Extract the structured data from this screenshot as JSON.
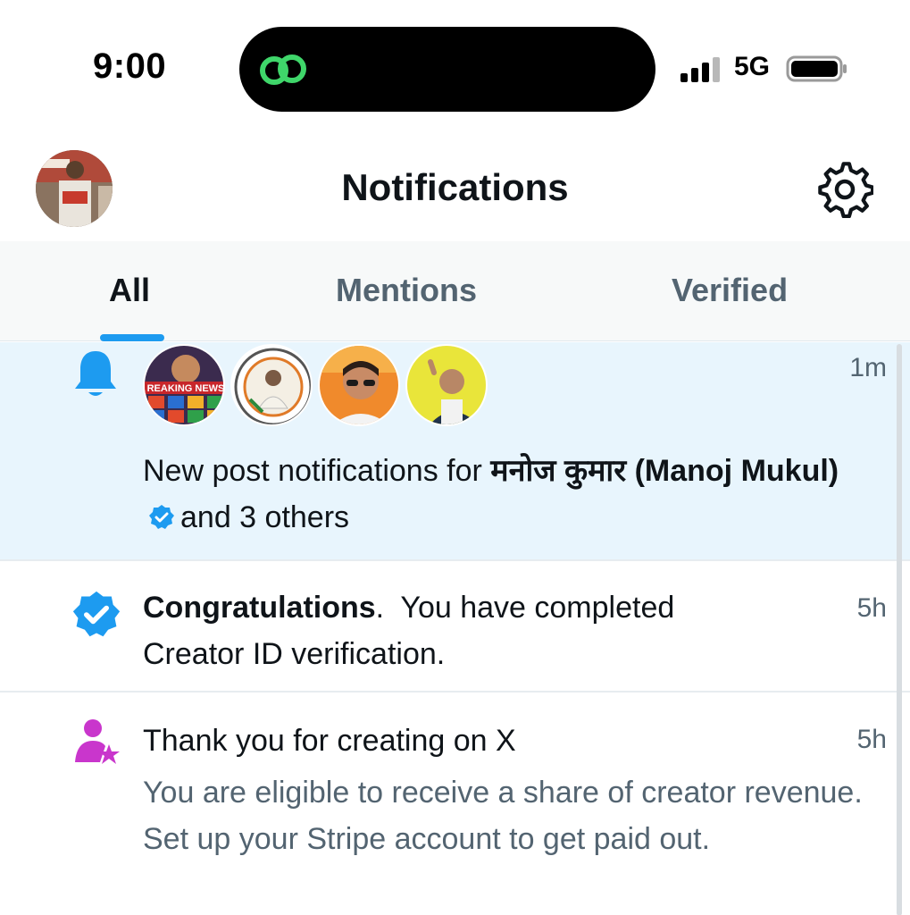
{
  "status_bar": {
    "time": "9:00",
    "network": "5G",
    "icons": [
      "link-icon",
      "signal-icon",
      "battery-icon"
    ]
  },
  "header": {
    "title": "Notifications",
    "settings_icon": "gear-icon"
  },
  "tabs": [
    {
      "label": "All",
      "active": true
    },
    {
      "label": "Mentions",
      "active": false
    },
    {
      "label": "Verified",
      "active": false
    }
  ],
  "notifications": [
    {
      "icon": "bell-icon",
      "time": "1m",
      "text_prefix": "New post notifications for ",
      "name": "मनोज कुमार (Manoj Mukul)",
      "text_suffix": "and 3 others",
      "avatar_caption": "REAKING NEWS"
    },
    {
      "icon": "verified-badge-icon",
      "time": "5h",
      "title": "Congratulations",
      "text": ".  You have completed Creator ID verification."
    },
    {
      "icon": "creator-star-icon",
      "time": "5h",
      "title": "Thank you for creating on X",
      "text": "You are eligible to receive a share of creator revenue. Set up your Stripe account to get paid out."
    }
  ],
  "colors": {
    "accent": "#1d9bf0",
    "highlight_bg": "#e8f5fd",
    "creator_purple": "#c936cc",
    "muted_text": "#536471"
  }
}
